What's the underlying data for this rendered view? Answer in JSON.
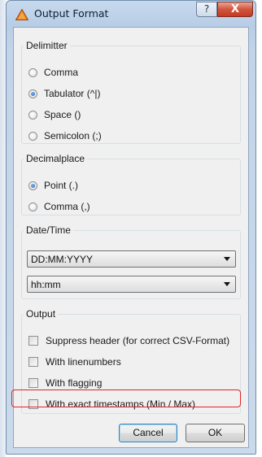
{
  "window": {
    "title": "Output Format",
    "help_label": "?",
    "close_label": "X"
  },
  "delimitter": {
    "legend": "Delimitter",
    "options": [
      {
        "label": "Comma",
        "selected": false
      },
      {
        "label": "Tabulator (^|)",
        "selected": true
      },
      {
        "label": "Space ()",
        "selected": false
      },
      {
        "label": "Semicolon (;)",
        "selected": false
      }
    ]
  },
  "decimalplace": {
    "legend": "Decimalplace",
    "options": [
      {
        "label": "Point (.)",
        "selected": true
      },
      {
        "label": "Comma (,)",
        "selected": false
      }
    ]
  },
  "datetime": {
    "legend": "Date/Time",
    "date_format": "DD:MM:YYYY",
    "time_format": "hh:mm"
  },
  "output": {
    "legend": "Output",
    "options": [
      {
        "label": "Suppress header (for correct CSV-Format)",
        "checked": false
      },
      {
        "label": "With linenumbers",
        "checked": false
      },
      {
        "label": "With flagging",
        "checked": false
      },
      {
        "label": "With exact timestamps (Min / Max)",
        "checked": false,
        "highlighted": true
      }
    ]
  },
  "buttons": {
    "cancel_label": "Cancel",
    "ok_label": "OK"
  },
  "colors": {
    "highlight_border": "#e0242a",
    "close_button": "#c63a22",
    "dialog_background": "#f0f0f0"
  }
}
